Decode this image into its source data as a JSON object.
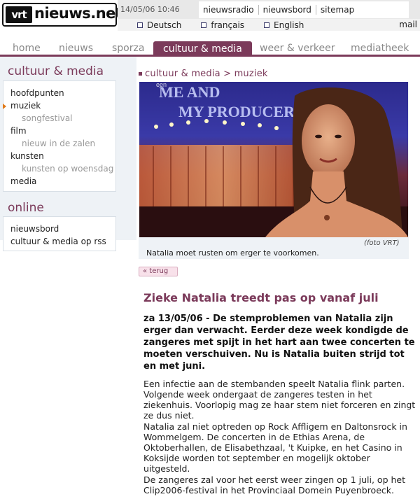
{
  "header": {
    "logo_vrt": "vrt",
    "logo_text": "nieuws.net",
    "datetime": "14/05/06 10:46",
    "top_links": [
      "nieuwsradio",
      "nieuwsbord",
      "sitemap"
    ],
    "languages": [
      "Deutsch",
      "français",
      "English"
    ],
    "mail": "mail"
  },
  "nav": {
    "tabs": [
      {
        "label": "home"
      },
      {
        "label": "nieuws"
      },
      {
        "label": "sporza"
      },
      {
        "label": "cultuur & media"
      },
      {
        "label": "weer & verkeer"
      },
      {
        "label": "mediatheek"
      }
    ],
    "active_index": 3
  },
  "sidebar": {
    "section_title": "cultuur & media",
    "items": [
      {
        "label": "hoofdpunten",
        "level": 0
      },
      {
        "label": "muziek",
        "level": 0,
        "current": true
      },
      {
        "label": "songfestival",
        "level": 1
      },
      {
        "label": "film",
        "level": 0
      },
      {
        "label": "nieuw in de zalen",
        "level": 1
      },
      {
        "label": "kunsten",
        "level": 0
      },
      {
        "label": "kunsten op woensdag",
        "level": 1
      },
      {
        "label": "media",
        "level": 0
      }
    ],
    "online_title": "online",
    "online_items": [
      {
        "label": "nieuwsbord"
      },
      {
        "label": "cultuur & media op rss"
      }
    ]
  },
  "breadcrumb": "cultuur & media  >  muziek",
  "photo": {
    "sign_text_1": "ME AND",
    "sign_text_2": "MY PRODUCER",
    "sign_small": "een",
    "credit": "(foto VRT)",
    "caption": "Natalia moet rusten om erger te voorkomen."
  },
  "back_label": "« terug",
  "article": {
    "title": "Zieke Natalia treedt pas op vanaf juli",
    "lead": "za 13/05/06 - De stemproblemen van Natalia zijn erger dan verwacht. Eerder deze week kondigde de zangeres met spijt in het hart aan twee concerten te moeten verschuiven. Nu is Natalia buiten strijd tot en met juni.",
    "paragraphs": [
      "Een infectie aan de stembanden speelt Natalia flink parten. Volgende week ondergaat de zangeres testen in het ziekenhuis. Voorlopig mag ze haar stem niet forceren en zingt ze dus niet.",
      "Natalia zal niet optreden op Rock Affligem en Daltonsrock in Wommelgem. De concerten in de Ethias Arena, de Oktoberhallen, de Elisabethzaal, 't Kuipke, en het Casino in Koksijde worden tot september en mogelijk oktober uitgesteld.",
      "De zangeres zal voor het eerst weer zingen op 1 juli, op het Clip2006-festival in het Provinciaal Domein Puyenbroeck."
    ]
  }
}
